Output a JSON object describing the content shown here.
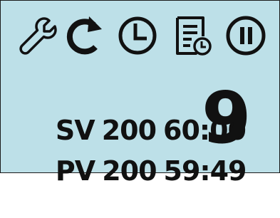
{
  "toolbar": {
    "icons": [
      "wrench-icon",
      "restart-icon",
      "timer-icon",
      "log-timer-icon",
      "pause-icon"
    ]
  },
  "set_value": {
    "label": "SV",
    "value": "200",
    "time": "60:00"
  },
  "process_value": {
    "label": "PV",
    "value": "200",
    "time": "59:49"
  },
  "step_number": "9",
  "colors": {
    "background": "#bde0e8",
    "foreground": "#111111"
  }
}
